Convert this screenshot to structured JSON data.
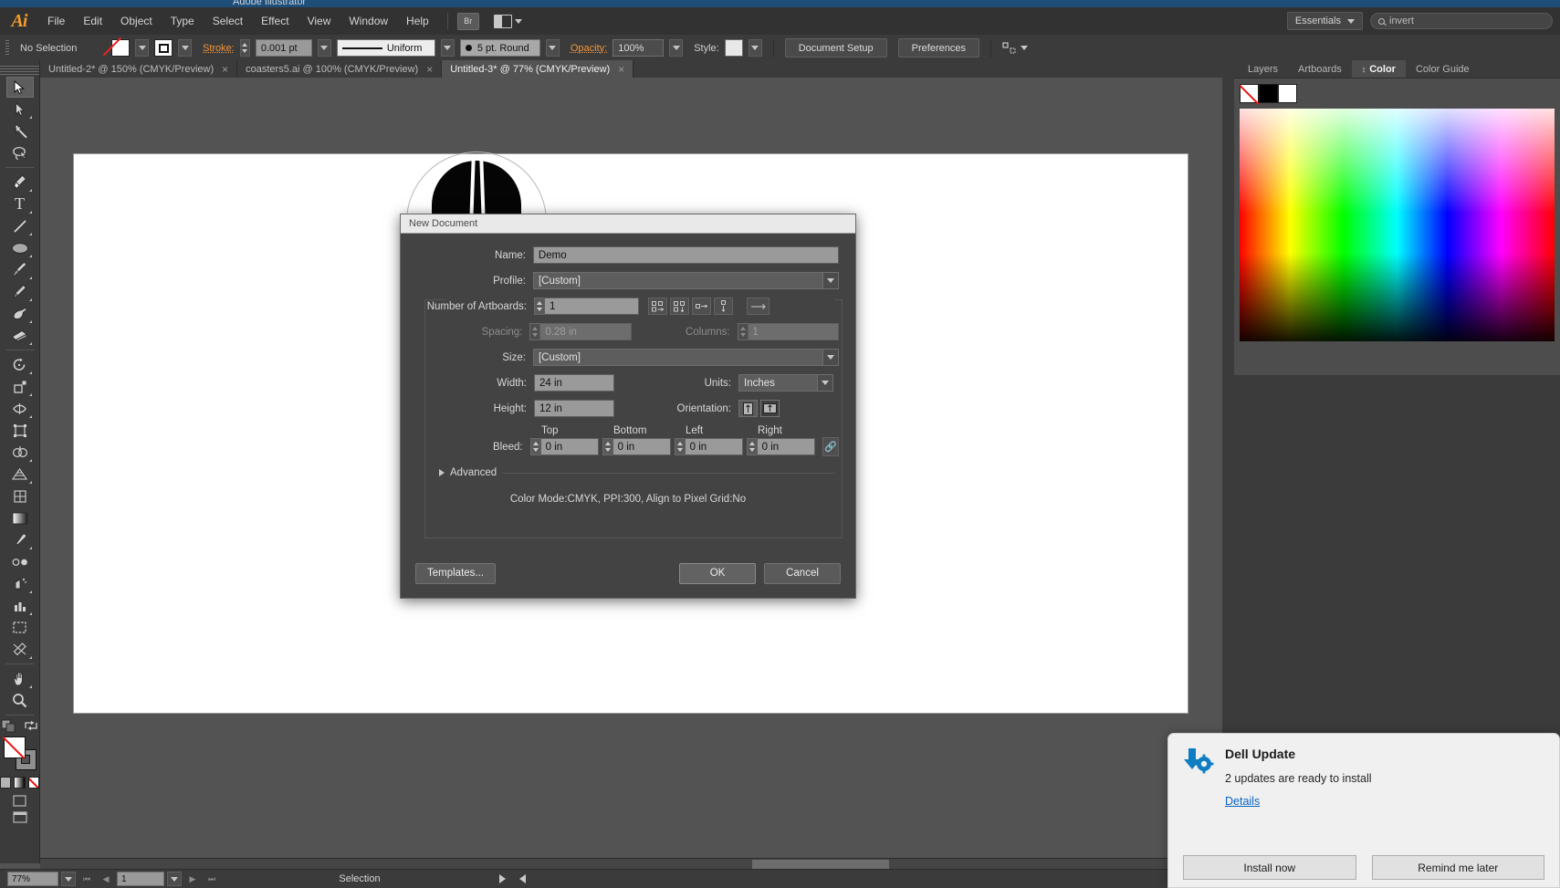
{
  "desktop": {
    "window_title": "Adobe Illustrator"
  },
  "menubar": {
    "logo": "Ai",
    "items": [
      "File",
      "Edit",
      "Object",
      "Type",
      "Select",
      "Effect",
      "View",
      "Window",
      "Help"
    ],
    "bridge_label": "Br",
    "workspace": "Essentials",
    "search_placeholder": "invert"
  },
  "controlbar": {
    "selection_status": "No Selection",
    "stroke_label": "Stroke:",
    "stroke_weight": "0.001 pt",
    "profile_label": "Uniform",
    "brush_label": "5 pt. Round",
    "opacity_label": "Opacity:",
    "opacity_value": "100%",
    "style_label": "Style:",
    "document_setup": "Document Setup",
    "preferences": "Preferences"
  },
  "tabs": [
    {
      "label": "Untitled-2* @ 150% (CMYK/Preview)",
      "active": false
    },
    {
      "label": "coasters5.ai @ 100% (CMYK/Preview)",
      "active": false
    },
    {
      "label": "Untitled-3* @ 77% (CMYK/Preview)",
      "active": true
    }
  ],
  "panel_tabs": [
    {
      "label": "Layers",
      "active": false
    },
    {
      "label": "Artboards",
      "active": false
    },
    {
      "label": "Color",
      "active": true
    },
    {
      "label": "Color Guide",
      "active": false
    }
  ],
  "statusbar": {
    "zoom": "77%",
    "page": "1",
    "tool": "Selection"
  },
  "dialog": {
    "title": "New Document",
    "name_label": "Name:",
    "name_value": "Demo",
    "profile_label": "Profile:",
    "profile_value": "[Custom]",
    "artboards_label": "Number of Artboards:",
    "artboards_value": "1",
    "spacing_label": "Spacing:",
    "spacing_value": "0.28 in",
    "columns_label": "Columns:",
    "columns_value": "1",
    "size_label": "Size:",
    "size_value": "[Custom]",
    "width_label": "Width:",
    "width_value": "24 in",
    "units_label": "Units:",
    "units_value": "Inches",
    "height_label": "Height:",
    "height_value": "12 in",
    "orientation_label": "Orientation:",
    "bleed_label": "Bleed:",
    "bleed_heads": [
      "Top",
      "Bottom",
      "Left",
      "Right"
    ],
    "bleed_values": [
      "0 in",
      "0 in",
      "0 in",
      "0 in"
    ],
    "advanced_label": "Advanced",
    "summary": "Color Mode:CMYK, PPI:300, Align to Pixel Grid:No",
    "templates_label": "Templates...",
    "ok_label": "OK",
    "cancel_label": "Cancel"
  },
  "toast": {
    "title": "Dell Update",
    "message": "2 updates are ready to install",
    "link": "Details",
    "install_label": "Install now",
    "remind_label": "Remind me later"
  },
  "colors": {
    "accent_orange": "#f79a2b",
    "app_bg": "#535353",
    "panel_bg": "#3b3b3b",
    "dialog_bg": "#434343",
    "link_blue": "#0a64c2"
  }
}
